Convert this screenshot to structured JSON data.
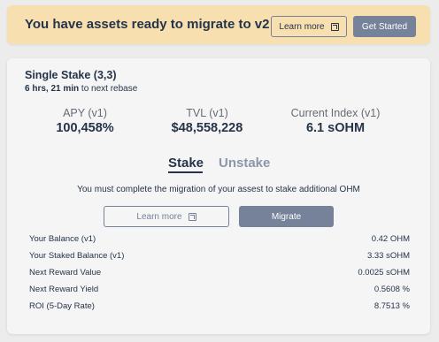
{
  "banner": {
    "message": "You have assets ready to migrate to v2",
    "learn_more_label": "Learn more",
    "get_started_label": "Get Started"
  },
  "card": {
    "title": "Single Stake (3,3)",
    "rebase_time": "6 hrs, 21 min",
    "rebase_suffix": " to next rebase",
    "metrics": [
      {
        "label": "APY (v1)",
        "value": "100,458%"
      },
      {
        "label": "TVL (v1)",
        "value": "$48,558,228"
      },
      {
        "label": "Current Index (v1)",
        "value": "6.1 sOHM"
      }
    ],
    "tabs": [
      {
        "label": "Stake",
        "active": true
      },
      {
        "label": "Unstake",
        "active": false
      }
    ],
    "notice": "You must complete the migration of your assest to stake additional OHM",
    "learn_more_label": "Learn more",
    "migrate_label": "Migrate",
    "stats": [
      {
        "label": "Your Balance (v1)",
        "value": "0.42 OHM"
      },
      {
        "label": "Your Staked Balance (v1)",
        "value": "3.33 sOHM"
      },
      {
        "label": "Next Reward Value",
        "value": "0.0025 sOHM"
      },
      {
        "label": "Next Reward Yield",
        "value": "0.5608 %"
      },
      {
        "label": "ROI (5-Day Rate)",
        "value": "8.7513 %"
      }
    ]
  },
  "colors": {
    "banner_bg": "#f8dfb0",
    "button_gray": "#768299",
    "text_dark": "#253449",
    "tab_inactive": "#8b96a8"
  }
}
